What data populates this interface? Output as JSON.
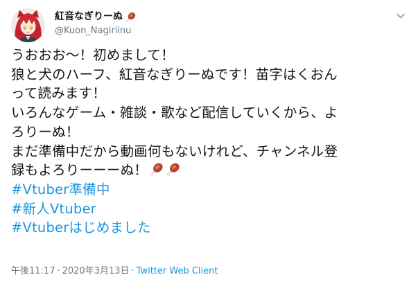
{
  "user": {
    "display_name": "紅音なぎりーぬ",
    "display_name_emoji": "meat-on-bone-icon",
    "handle": "@Kuon_Nagiriinu"
  },
  "tweet": {
    "lines": [
      "うおおお〜！初めまして！",
      "狼と犬のハーフ、紅音なぎりーぬです！苗字はくおん",
      "って読みます！",
      "いろんなゲーム・雑談・歌など配信していくから、よ",
      "ろりーぬ！",
      "まだ準備中だから動画何もないけれど、チャンネル登",
      "録もよろりーーーぬ！"
    ],
    "trailing_emojis": [
      "meat-on-bone-icon",
      "meat-on-bone-icon"
    ],
    "hashtags": [
      "#Vtuber準備中",
      "#新人Vtuber",
      "#Vtuberはじめました"
    ]
  },
  "meta": {
    "time": "午後11:17",
    "separator": "·",
    "date": "2020年3月13日",
    "client": "Twitter Web Client"
  },
  "colors": {
    "text": "#14171a",
    "secondary": "#657786",
    "link": "#1b95e0"
  }
}
